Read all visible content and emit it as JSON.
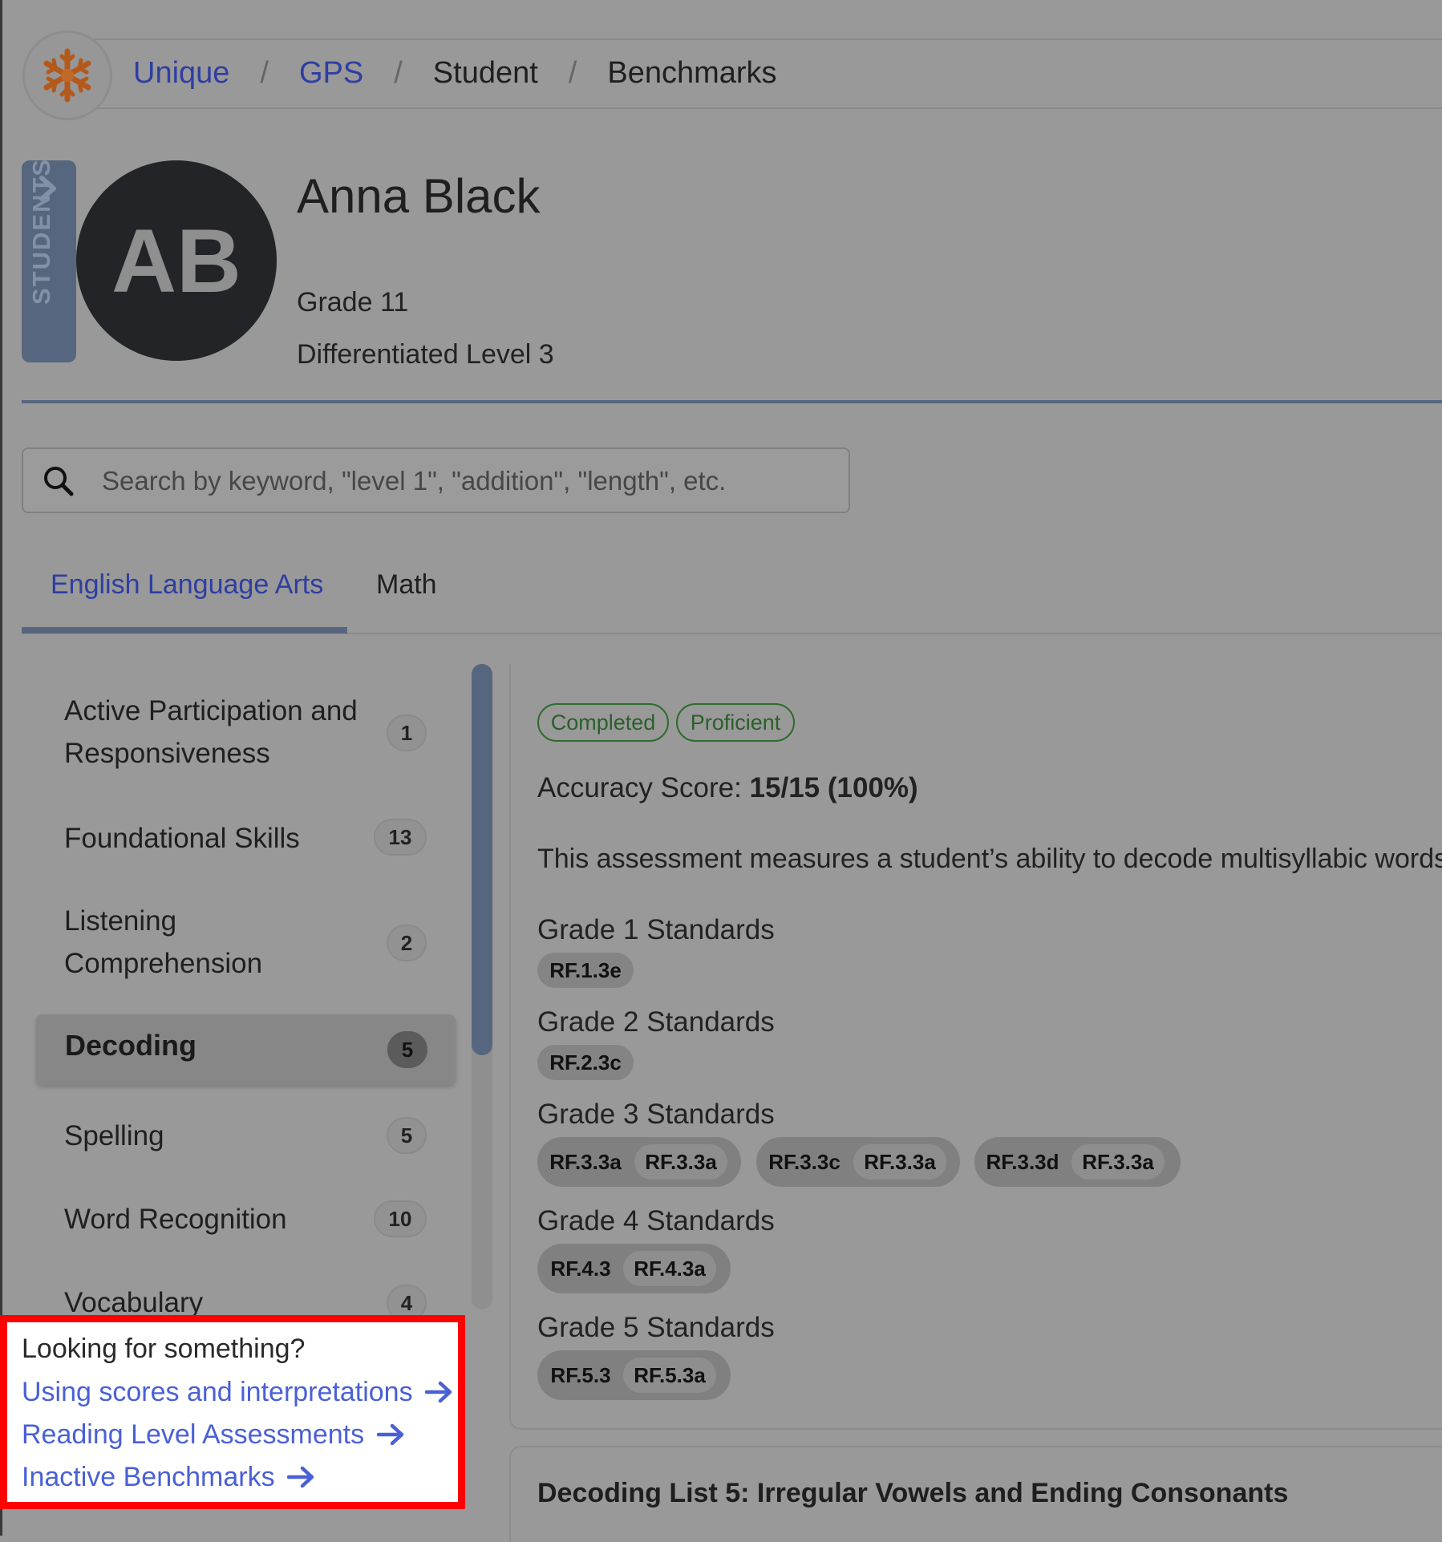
{
  "breadcrumb": {
    "items": [
      {
        "label": "Unique"
      },
      {
        "label": "GPS"
      },
      {
        "label": "Student"
      },
      {
        "label": "Benchmarks"
      }
    ],
    "separator": "/"
  },
  "students_tab": {
    "label": "STUDENTS"
  },
  "student": {
    "initials": "AB",
    "name": "Anna Black",
    "grade": "Grade 11",
    "level": "Differentiated Level 3"
  },
  "search": {
    "placeholder": "Search by keyword, \"level 1\", \"addition\", \"length\", etc."
  },
  "tabs": [
    {
      "label": "English Language Arts",
      "active": true
    },
    {
      "label": "Math",
      "active": false
    }
  ],
  "categories": [
    {
      "label_line1": "Active Participation and",
      "label_line2": "Responsiveness",
      "count": "1"
    },
    {
      "label": "Foundational Skills",
      "count": "13"
    },
    {
      "label_line1": "Listening",
      "label_line2": "Comprehension",
      "count": "2"
    },
    {
      "label": "Decoding",
      "count": "5",
      "selected": true
    },
    {
      "label": "Spelling",
      "count": "5"
    },
    {
      "label": "Word Recognition",
      "count": "10"
    },
    {
      "label": "Vocabulary",
      "count": "4"
    }
  ],
  "help": {
    "title": "Looking for something?",
    "links": [
      {
        "label": "Using scores and interpretations"
      },
      {
        "label": "Reading Level Assessments"
      },
      {
        "label": "Inactive Benchmarks"
      }
    ]
  },
  "assessment": {
    "status_pills": [
      "Completed",
      "Proficient"
    ],
    "accuracy_label": "Accuracy Score:",
    "accuracy_value": "15/15 (100%)",
    "description": "This assessment measures a student’s ability to decode multisyllabic words",
    "standards": [
      {
        "heading": "Grade 1 Standards",
        "groups": [
          [
            "RF.1.3e"
          ]
        ]
      },
      {
        "heading": "Grade 2 Standards",
        "groups": [
          [
            "RF.2.3c"
          ]
        ]
      },
      {
        "heading": "Grade 3 Standards",
        "groups": [
          [
            "RF.3.3a",
            "RF.3.3a"
          ],
          [
            "RF.3.3c",
            "RF.3.3a"
          ],
          [
            "RF.3.3d",
            "RF.3.3a"
          ]
        ]
      },
      {
        "heading": "Grade 4 Standards",
        "groups": [
          [
            "RF.4.3",
            "RF.4.3a"
          ]
        ]
      },
      {
        "heading": "Grade 5 Standards",
        "groups": [
          [
            "RF.5.3",
            "RF.5.3a"
          ]
        ]
      }
    ]
  },
  "next_card": {
    "title": "Decoding List 5: Irregular Vowels and Ending Consonants"
  },
  "colors": {
    "link_blue": "#2e3ea1",
    "accent_slate": "#56667f",
    "success_green": "#2e6b2e",
    "highlight_red": "#ff0000"
  },
  "icons": {
    "logo": "snowflake-icon",
    "search": "search-icon",
    "students_tab": "chevron-right-icon",
    "help_links": "arrow-right-icon"
  }
}
